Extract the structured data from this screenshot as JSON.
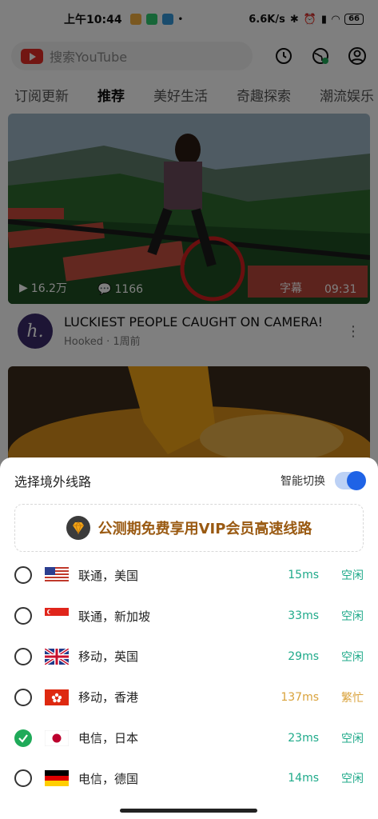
{
  "status_bar": {
    "time": "上午10:44",
    "net_speed": "6.6K/s",
    "battery": "66"
  },
  "header": {
    "search_placeholder": "搜索YouTube"
  },
  "tabs": [
    {
      "label": "订阅更新",
      "active": false
    },
    {
      "label": "推荐",
      "active": true
    },
    {
      "label": "美好生活",
      "active": false
    },
    {
      "label": "奇趣探索",
      "active": false
    },
    {
      "label": "潮流娱乐",
      "active": false
    }
  ],
  "video1": {
    "views": "16.2万",
    "comments": "1166",
    "caption_tag": "字幕",
    "duration": "09:31",
    "channel_avatar_letter": "h.",
    "title": "LUCKIEST PEOPLE CAUGHT ON CAMERA!",
    "channel": "Hooked",
    "age": "1周前"
  },
  "sheet": {
    "title": "选择境外线路",
    "smart_switch_label": "智能切换",
    "smart_switch_on": true,
    "vip_banner": "公测期免费享用VIP会员高速线路",
    "routes": [
      {
        "name": "联通，美国",
        "latency": "15ms",
        "status": "空闲",
        "flag": "us-flag",
        "selected": false,
        "busy": false
      },
      {
        "name": "联通，新加坡",
        "latency": "33ms",
        "status": "空闲",
        "flag": "sg-flag",
        "selected": false,
        "busy": false
      },
      {
        "name": "移动，英国",
        "latency": "29ms",
        "status": "空闲",
        "flag": "uk-flag",
        "selected": false,
        "busy": false
      },
      {
        "name": "移动，香港",
        "latency": "137ms",
        "status": "繁忙",
        "flag": "hk-flag",
        "selected": false,
        "busy": true
      },
      {
        "name": "电信，日本",
        "latency": "23ms",
        "status": "空闲",
        "flag": "jp-flag",
        "selected": true,
        "busy": false
      },
      {
        "name": "电信，德国",
        "latency": "14ms",
        "status": "空闲",
        "flag": "de-flag",
        "selected": false,
        "busy": false
      }
    ]
  },
  "colors": {
    "accent_red": "#e52d27",
    "toggle_blue": "#1f63e6",
    "idle_green": "#1faa8a",
    "busy_orange": "#d9a23b",
    "check_green": "#1faa59"
  }
}
